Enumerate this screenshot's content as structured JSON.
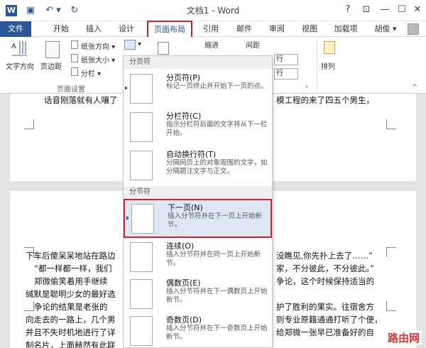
{
  "titlebar": {
    "title": "文档1 - Word",
    "help": "?",
    "ribbon_display": "⊡",
    "minimize": "—",
    "restore": "☐",
    "close": "✕",
    "qa_word": "W",
    "qa_save": "▣",
    "qa_undo": "↶ ▾",
    "qa_redo": "↻"
  },
  "tabs": {
    "file": "文件",
    "home": "开始",
    "insert": "插入",
    "design": "设计",
    "layout": "页面布局",
    "references": "引用",
    "mailings": "邮件",
    "review": "审阅",
    "view": "视图",
    "addins": "加载项",
    "user": "胡俊 ▾"
  },
  "ribbon": {
    "text_direction": "文字方向",
    "margins": "页边距",
    "orientation": "纸张方向 ▾",
    "size": "纸张大小 ▾",
    "columns": "分栏 ▾",
    "breaks_icon": "▾",
    "indent": "缩进",
    "spacing": "间距",
    "arrange": "排列",
    "page_setup_group": "页面设置",
    "spacing_dropdown_1": "行",
    "spacing_dropdown_2": "行",
    "collapse": "^",
    "dialog_launcher": "⌞"
  },
  "menu": {
    "section_page": "分页符",
    "section_section": "分节符",
    "items": [
      {
        "title": "分页符(P)",
        "desc": "标记一页终止并开始下一页的点。"
      },
      {
        "title": "分栏符(C)",
        "desc": "指示分栏符后面的文字将从下一栏开始。"
      },
      {
        "title": "自动换行符(T)",
        "desc": "分隔网页上的对象周围的文字，如分隔题注文字与正文。"
      },
      {
        "title": "下一页(N)",
        "desc": "插入分节符并在下一页上开始新节。"
      },
      {
        "title": "连续(O)",
        "desc": "插入分节符并在同一页上开始新节。"
      },
      {
        "title": "偶数页(E)",
        "desc": "插入分节符并在下一偶数页上开始新节。"
      },
      {
        "title": "奇数页(D)",
        "desc": "插入分节符并在下一奇数页上开始新节。"
      }
    ]
  },
  "document": {
    "lines": [
      "话音刚落就有人嚷了",
      "模工程的来了四五个男生，",
      "下车后傻呆呆地站在路边",
      "没瞧见,你先扑上去了……”",
      "“都一样都一样，我们",
      "家，不分彼此，不分彼此。”",
      "郑微偷笑着用手继续",
      "争论，这个时候保持适当的",
      "缄默是聪明少女的最好选",
      "争论的结果是老张的",
      "护了胜利的果实。往宿舍方",
      "向走去的一路上，几个男",
      "则专业原籍通通打听了个便，",
      "并且不失时机地进行了详",
      "给郑微一张早已准备好的自",
      "制名片，上面赫然有此联"
    ]
  },
  "watermark": "路由网"
}
